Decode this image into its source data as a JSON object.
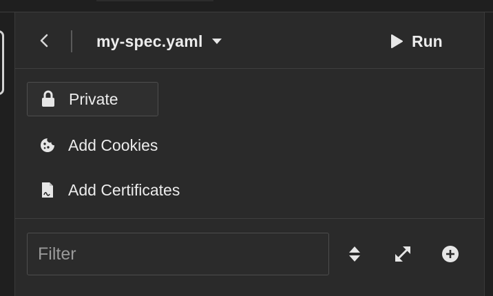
{
  "header": {
    "spec_name": "my-spec.yaml",
    "run_label": "Run"
  },
  "options": {
    "private_label": "Private",
    "add_cookies_label": "Add Cookies",
    "add_certificates_label": "Add Certificates"
  },
  "filter": {
    "placeholder": "Filter",
    "value": ""
  },
  "icons": {
    "back": "chevron-left-icon",
    "spec_dropdown": "caret-down-icon",
    "run": "play-icon",
    "private": "lock-icon",
    "cookies": "cookie-icon",
    "certificates": "certificate-file-icon",
    "sort": "sort-icon",
    "expand": "expand-icon",
    "add": "plus-circle-icon"
  },
  "colors": {
    "panel_background": "#2a2a2a",
    "text": "#ececec",
    "border": "#4e4e4e",
    "placeholder": "#9a9a9a"
  }
}
